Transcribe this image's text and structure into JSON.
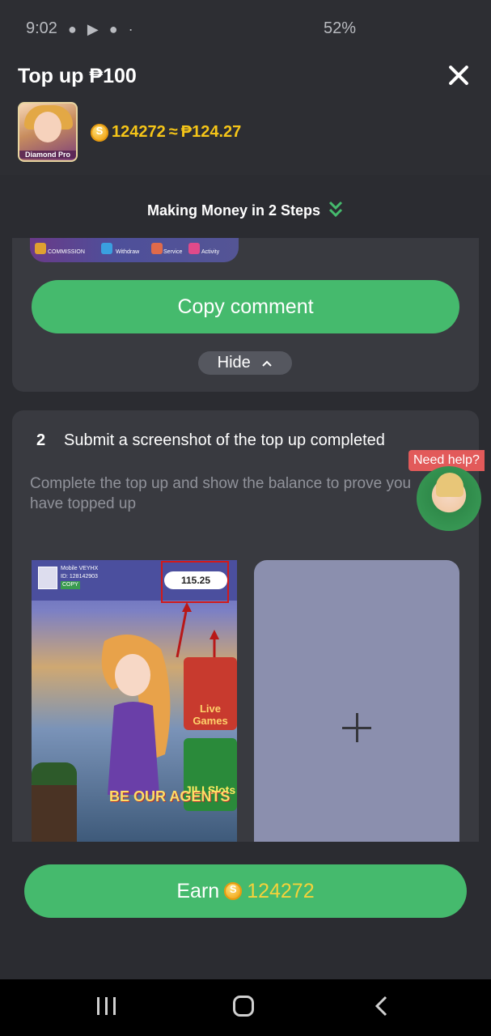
{
  "status_bar": {
    "time": "9:02",
    "battery": "52%"
  },
  "header": {
    "title": "Top up ₱100",
    "app_icon_label": "Diamond Pro",
    "coins": "124272",
    "approx": "≈",
    "peso_value": "₱124.27"
  },
  "steps_heading": "Making Money in 2 Steps",
  "step1": {
    "strip_labels": [
      "COMMISSION",
      "Withdraw",
      "Service",
      "Activity"
    ],
    "copy_button": "Copy comment",
    "hide_button": "Hide"
  },
  "step2": {
    "number": "2",
    "title": "Submit a screenshot of the top up completed",
    "description": "Complete the top up and show the balance to prove you have topped up",
    "example_image": {
      "user_name": "Mobile VEYHX",
      "user_id": "ID: 128142903",
      "copy_label": "COPY",
      "balance": "115.25",
      "live_games": "Live Games",
      "jili_slots": "JILI Slots",
      "agents_text": "BE OUR AGENTS"
    }
  },
  "help": {
    "label": "Need help?"
  },
  "earn_button": {
    "label": "Earn",
    "amount": "124272"
  },
  "colors": {
    "accent_green": "#45ba6d",
    "coin_gold": "#f5c518",
    "help_red": "#e25a5a",
    "background": "#2b2c31"
  }
}
